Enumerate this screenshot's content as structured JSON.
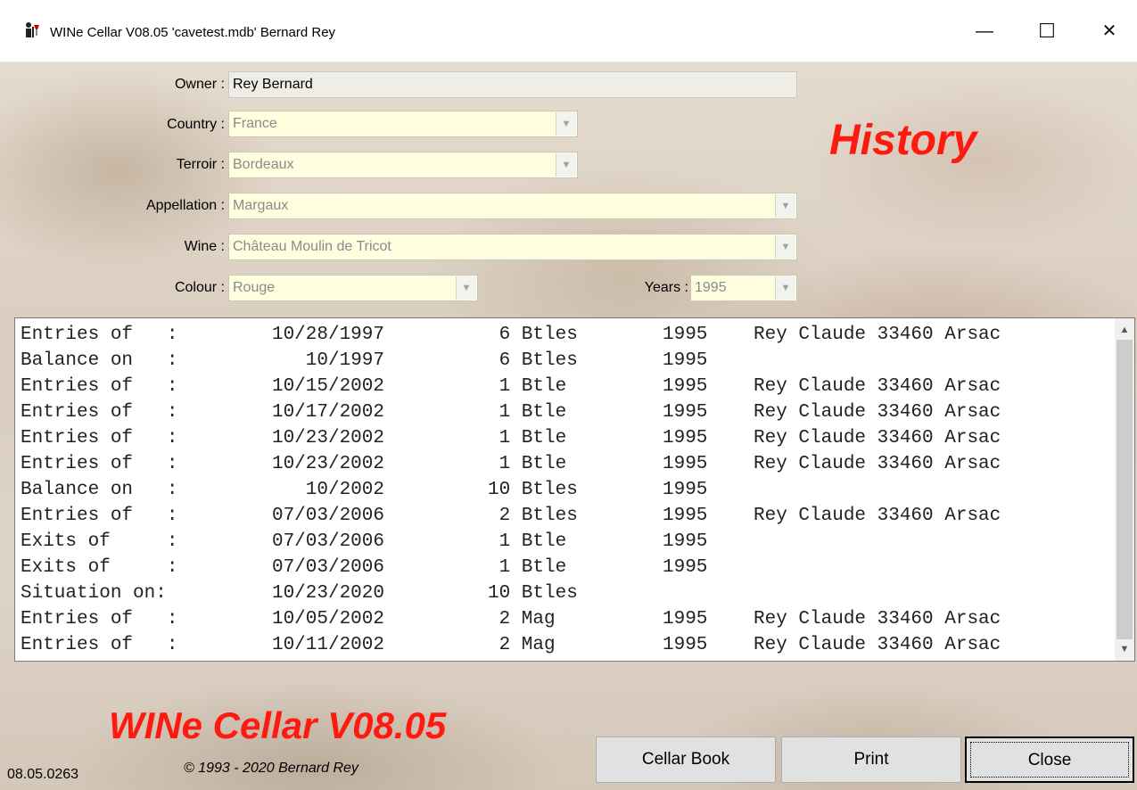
{
  "window": {
    "title": "WINe Cellar V08.05  'cavetest.mdb'  Bernard Rey",
    "minimize_glyph": "—",
    "maximize_glyph": "☐",
    "close_glyph": "✕"
  },
  "form": {
    "owner_label": "Owner :",
    "owner_value": "Rey Bernard",
    "country_label": "Country :",
    "country_value": "France",
    "terroir_label": "Terroir :",
    "terroir_value": "Bordeaux",
    "appellation_label": "Appellation :",
    "appellation_value": "Margaux",
    "wine_label": "Wine :",
    "wine_value": "Château Moulin de Tricot",
    "colour_label": "Colour :",
    "colour_value": "Rouge",
    "years_label": "Years :",
    "years_value": "1995"
  },
  "heading": "History",
  "history": [
    {
      "type": "Entries of   :",
      "date": "10/28/1997",
      "qty": " 6 Btles",
      "year": "1995",
      "supplier": "Rey Claude 33460 Arsac"
    },
    {
      "type": "Balance on   :",
      "date": "10/1997",
      "qty": " 6 Btles",
      "year": "1995",
      "supplier": ""
    },
    {
      "type": "Entries of   :",
      "date": "10/15/2002",
      "qty": " 1 Btle",
      "year": "1995",
      "supplier": "Rey Claude 33460 Arsac"
    },
    {
      "type": "Entries of   :",
      "date": "10/17/2002",
      "qty": " 1 Btle",
      "year": "1995",
      "supplier": "Rey Claude 33460 Arsac"
    },
    {
      "type": "Entries of   :",
      "date": "10/23/2002",
      "qty": " 1 Btle",
      "year": "1995",
      "supplier": "Rey Claude 33460 Arsac"
    },
    {
      "type": "Entries of   :",
      "date": "10/23/2002",
      "qty": " 1 Btle",
      "year": "1995",
      "supplier": "Rey Claude 33460 Arsac"
    },
    {
      "type": "Balance on   :",
      "date": "10/2002",
      "qty": "10 Btles",
      "year": "1995",
      "supplier": ""
    },
    {
      "type": "Entries of   :",
      "date": "07/03/2006",
      "qty": " 2 Btles",
      "year": "1995",
      "supplier": "Rey Claude 33460 Arsac"
    },
    {
      "type": "Exits of     :",
      "date": "07/03/2006",
      "qty": " 1 Btle",
      "year": "1995",
      "supplier": ""
    },
    {
      "type": "Exits of     :",
      "date": "07/03/2006",
      "qty": " 1 Btle",
      "year": "1995",
      "supplier": ""
    },
    {
      "type": "Situation on:",
      "date": "10/23/2020",
      "qty": "10 Btles",
      "year": "",
      "supplier": ""
    },
    {
      "type": "Entries of   :",
      "date": "10/05/2002",
      "qty": " 2 Mag",
      "year": "1995",
      "supplier": "Rey Claude 33460 Arsac"
    },
    {
      "type": "Entries of   :",
      "date": "10/11/2002",
      "qty": " 2 Mag",
      "year": "1995",
      "supplier": "Rey Claude 33460 Arsac"
    }
  ],
  "footer": {
    "brand": "WINe Cellar V08.05",
    "copyright": "© 1993 - 2020 Bernard Rey",
    "build": "08.05.0263",
    "cellar_book_label": "Cellar Book",
    "print_label": "Print",
    "close_label": "Close"
  }
}
